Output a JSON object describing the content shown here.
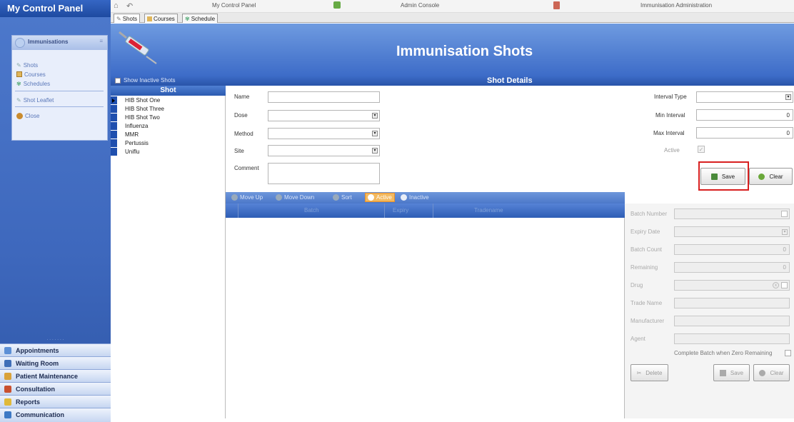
{
  "sidebar": {
    "title": "My Control Panel",
    "group": "Immunisations",
    "items": [
      {
        "label": "Shots",
        "icon": "syringe-icon"
      },
      {
        "label": "Courses",
        "icon": "calendar-icon"
      },
      {
        "label": "Schedules",
        "icon": "schedule-icon"
      },
      {
        "label": "Shot Leaflet",
        "icon": "syringe-icon"
      },
      {
        "label": "Close",
        "icon": "close-icon"
      }
    ],
    "nav": [
      {
        "label": "Appointments",
        "color": "#5c8fd6"
      },
      {
        "label": "Waiting Room",
        "color": "#3f6fb8"
      },
      {
        "label": "Patient Maintenance",
        "color": "#d9a23a"
      },
      {
        "label": "Consultation",
        "color": "#c9502f"
      },
      {
        "label": "Reports",
        "color": "#e0b93a"
      },
      {
        "label": "Communication",
        "color": "#3d79c5"
      },
      {
        "label": "My Control Panel",
        "color": "#7a8fa8"
      }
    ]
  },
  "topbar": {
    "items": [
      "My Control Panel",
      "Admin Console",
      "Immunisation Administration"
    ]
  },
  "tabs": [
    "Shots",
    "Courses",
    "Schedule"
  ],
  "header": {
    "title": "Immunisation Shots",
    "accent": "#3d6cc8"
  },
  "details": {
    "show_inactive": "Show Inactive Shots",
    "title": "Shot Details"
  },
  "shotlist": {
    "header": "Shot",
    "items": [
      "HIB Shot One",
      "HIB Shot Three",
      "HIB Shot Two",
      "Influenza",
      "MMR",
      "Pertussis",
      "Uniflu"
    ]
  },
  "form": {
    "name_label": "Name",
    "dose_label": "Dose",
    "method_label": "Method",
    "site_label": "Site",
    "comment_label": "Comment",
    "interval_type_label": "Interval Type",
    "min_interval_label": "Min Interval",
    "min_interval_value": "0",
    "max_interval_label": "Max Interval",
    "max_interval_value": "0",
    "active_label": "Active",
    "save_label": "Save",
    "clear_label": "Clear"
  },
  "batch_toolbar": {
    "move_up": "Move Up",
    "move_down": "Move Down",
    "sort": "Sort",
    "active": "Active",
    "inactive": "Inactive"
  },
  "batch_grid": {
    "columns": [
      "Batch",
      "Expiry",
      "Tradename"
    ]
  },
  "batch_panel": {
    "batch_number": "Batch Number",
    "expiry_date": "Expiry Date",
    "batch_count": "Batch Count",
    "batch_count_value": "0",
    "remaining": "Remaining",
    "remaining_value": "0",
    "drug": "Drug",
    "trade_name": "Trade Name",
    "manufacturer": "Manufacturer",
    "agent": "Agent",
    "complete_batch": "Complete Batch when Zero Remaining",
    "delete_label": "Delete",
    "save_label": "Save",
    "clear_label": "Clear"
  }
}
